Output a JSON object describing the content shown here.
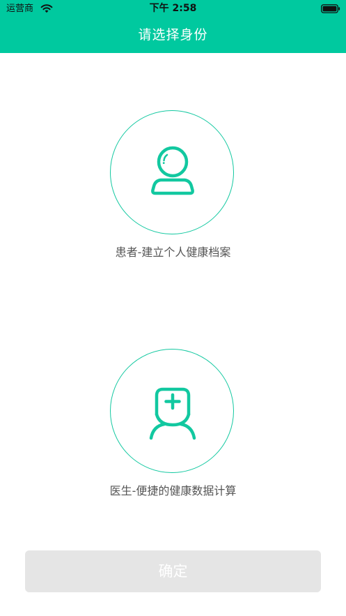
{
  "status_bar": {
    "carrier": "运营商",
    "time": "下午 2:58",
    "wifi_icon": "wifi-icon",
    "battery_icon": "battery-icon"
  },
  "nav": {
    "title": "请选择身份"
  },
  "roles": [
    {
      "icon": "patient-person-icon",
      "label": "患者-建立个人健康档案"
    },
    {
      "icon": "doctor-cross-icon",
      "label": "医生-便捷的健康数据计算"
    }
  ],
  "confirm_button": {
    "label": "确定",
    "enabled": false
  },
  "colors": {
    "accent": "#00c99f",
    "icon_stroke": "#12c8a0",
    "button_disabled_bg": "#e5e5e5",
    "label_text": "#555555"
  }
}
